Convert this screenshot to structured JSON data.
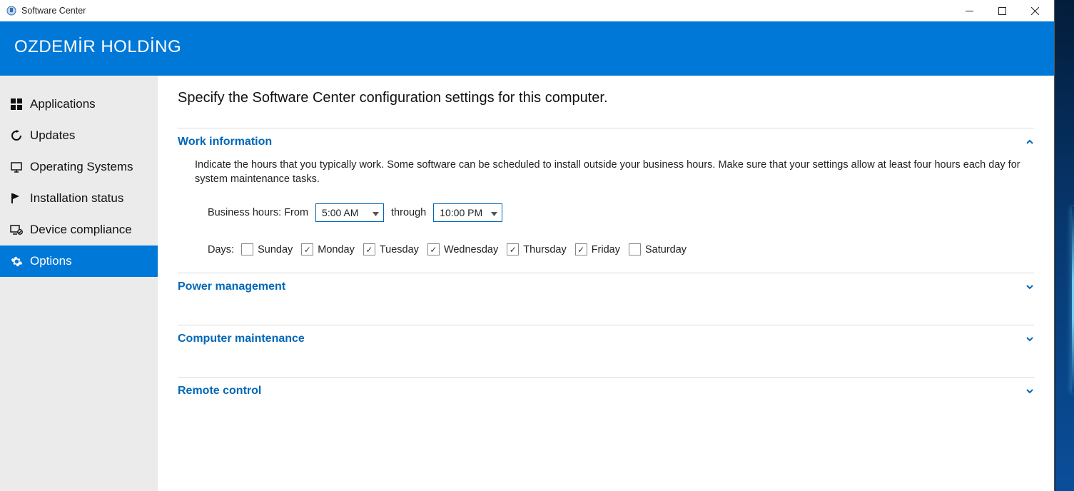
{
  "window": {
    "title": "Software Center"
  },
  "brand": {
    "title": "OZDEMİR HOLDİNG"
  },
  "sidebar": {
    "items": [
      {
        "label": "Applications"
      },
      {
        "label": "Updates"
      },
      {
        "label": "Operating Systems"
      },
      {
        "label": "Installation status"
      },
      {
        "label": "Device compliance"
      },
      {
        "label": "Options"
      }
    ]
  },
  "page": {
    "description": "Specify the Software Center configuration settings for this computer."
  },
  "sections": {
    "work_information": {
      "title": "Work information",
      "description": "Indicate the hours that you typically work. Some software can be scheduled to install outside your business hours. Make sure that your settings allow at least four hours each day for system maintenance tasks.",
      "business_hours_label": "Business hours: From",
      "through_label": "through",
      "from_value": "5:00 AM",
      "to_value": "10:00 PM",
      "days_label": "Days:",
      "days": [
        {
          "label": "Sunday",
          "checked": false
        },
        {
          "label": "Monday",
          "checked": true
        },
        {
          "label": "Tuesday",
          "checked": true
        },
        {
          "label": "Wednesday",
          "checked": true
        },
        {
          "label": "Thursday",
          "checked": true
        },
        {
          "label": "Friday",
          "checked": true
        },
        {
          "label": "Saturday",
          "checked": false
        }
      ]
    },
    "power_management": {
      "title": "Power management"
    },
    "computer_maintenance": {
      "title": "Computer maintenance"
    },
    "remote_control": {
      "title": "Remote control"
    }
  }
}
